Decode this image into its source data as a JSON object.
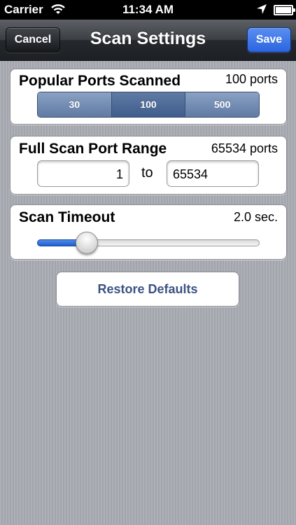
{
  "status_bar": {
    "carrier": "Carrier",
    "time": "11:34 AM",
    "icons": [
      "wifi-icon",
      "location-arrow-icon",
      "battery-icon"
    ]
  },
  "nav": {
    "title": "Scan Settings",
    "cancel_label": "Cancel",
    "save_label": "Save"
  },
  "popular_ports": {
    "title": "Popular Ports Scanned",
    "value": "100 ports",
    "options": [
      "30",
      "100",
      "500"
    ],
    "selected": "100"
  },
  "full_scan": {
    "title": "Full Scan Port Range",
    "value": "65534 ports",
    "from": "1",
    "to_label": "to",
    "to": "65534"
  },
  "timeout": {
    "title": "Scan Timeout",
    "value": "2.0 sec.",
    "slider_fraction": 0.22
  },
  "restore_label": "Restore Defaults",
  "colors": {
    "accent_blue": "#2a64e0",
    "segment_blue": "#5f7aa4",
    "restore_text": "#3b5283",
    "background": "#a9acb3"
  }
}
